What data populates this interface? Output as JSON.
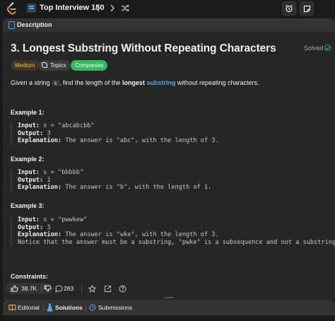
{
  "topbar": {
    "list_title": "Top Interview 150",
    "icons": [
      "leetcode-logo",
      "list-icon",
      "chevron-left-icon",
      "chevron-right-icon",
      "shuffle-icon",
      "alarm-icon",
      "notes-icon"
    ]
  },
  "tab": {
    "label": "Description"
  },
  "problem": {
    "title": "3. Longest Substring Without Repeating Characters",
    "status": "Solved",
    "tags": {
      "difficulty": "Medium",
      "topics": "Topics",
      "companies": "Companies"
    },
    "desc_prefix": "Given a string ",
    "desc_code": "s",
    "desc_mid": ", find the length of the ",
    "desc_bold": "longest",
    "desc_link": "substring",
    "desc_suffix": " without repeating characters."
  },
  "examples": [
    {
      "heading": "Example 1:",
      "input_label": "Input:",
      "input_value": "s = \"abcabcbb\"",
      "output_label": "Output:",
      "output_value": "3",
      "explanation_label": "Explanation:",
      "explanation_value": "The answer is \"abc\", with the length of 3."
    },
    {
      "heading": "Example 2:",
      "input_label": "Input:",
      "input_value": "s = \"bbbbb\"",
      "output_label": "Output:",
      "output_value": "1",
      "explanation_label": "Explanation:",
      "explanation_value": "The answer is \"b\", with the length of 1."
    },
    {
      "heading": "Example 3:",
      "input_label": "Input:",
      "input_value": "s = \"pwwkew\"",
      "output_label": "Output:",
      "output_value": "3",
      "explanation_label": "Explanation:",
      "explanation_value": "The answer is \"wke\", with the length of 3.",
      "note": "Notice that the answer must be a substring, \"pwke\" is a subsequence and not a substring."
    }
  ],
  "constraints": {
    "heading": "Constraints:"
  },
  "actions": {
    "likes": "38.7K",
    "comments": "283"
  },
  "bottom_tabs": {
    "editorial": "Editorial",
    "solutions": "Solutions",
    "submissions": "Submissions"
  },
  "colors": {
    "accent_blue": "#4aa8ff",
    "easy_green": "#2cbb5d",
    "medium_yellow": "#ffc01e",
    "bg": "#1a1a1a",
    "panel": "#262626"
  }
}
